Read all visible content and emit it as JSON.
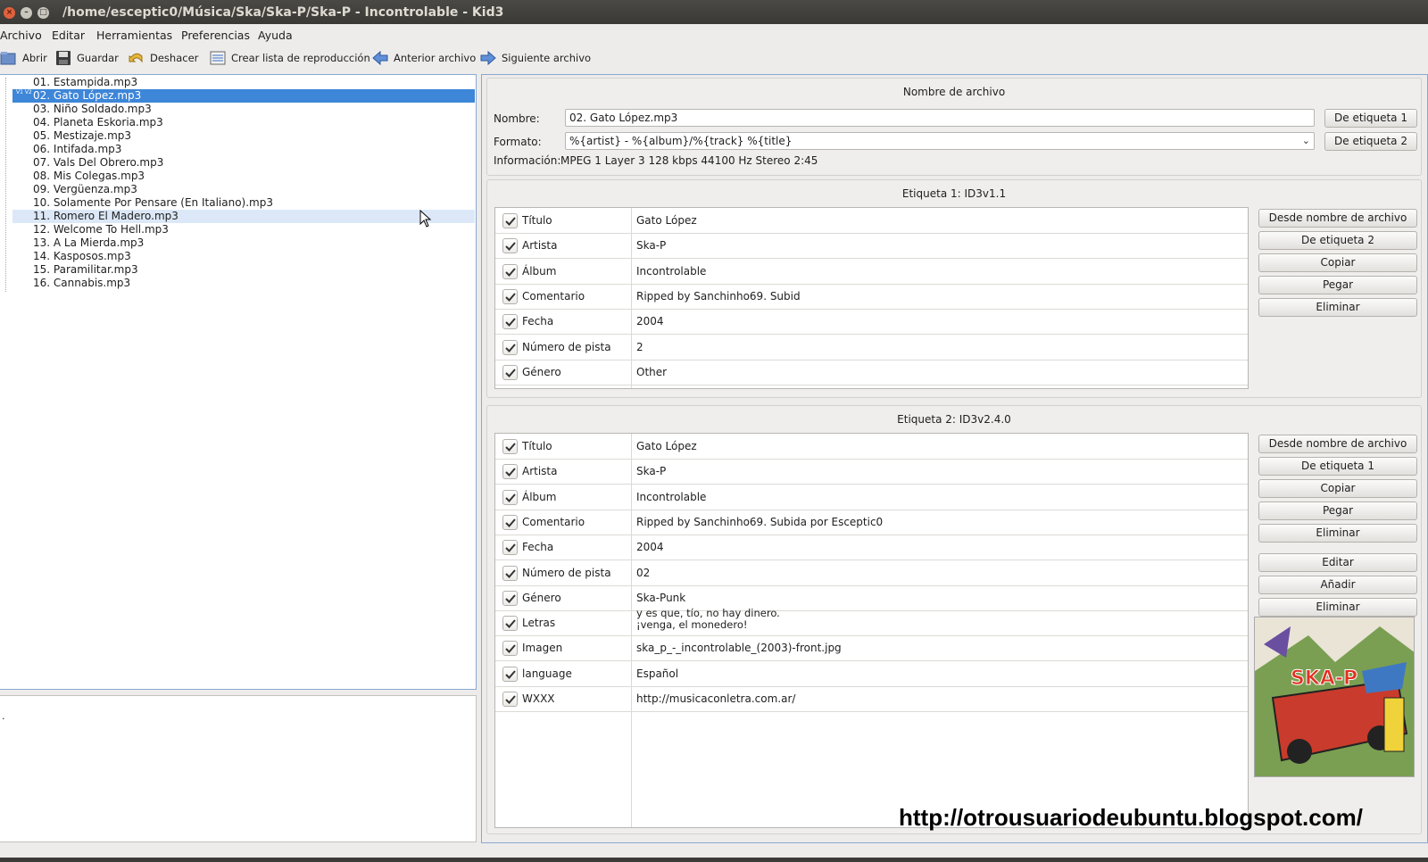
{
  "window": {
    "title": "/home/esceptic0/Música/Ska/Ska-P/Ska-P - Incontrolable - Kid3"
  },
  "menu": [
    "Archivo",
    "Editar",
    "Herramientas",
    "Preferencias",
    "Ayuda"
  ],
  "toolbar": {
    "open": "Abrir",
    "save": "Guardar",
    "undo": "Deshacer",
    "playlist": "Crear lista de reproducción",
    "prev": "Anterior archivo",
    "next": "Siguiente archivo"
  },
  "files": [
    "01. Estampida.mp3",
    "02. Gato López.mp3",
    "03. Niño Soldado.mp3",
    "04. Planeta Eskoria.mp3",
    "05. Mestizaje.mp3",
    "06. Intifada.mp3",
    "07. Vals Del Obrero.mp3",
    "08. Mis Colegas.mp3",
    "09. Vergüenza.mp3",
    "10. Solamente Por Pensare (En Italiano).mp3",
    "11. Romero El Madero.mp3",
    "12. Welcome To Hell.mp3",
    "13. A La Mierda.mp3",
    "14. Kasposos.mp3",
    "15. Paramilitar.mp3",
    "16. Cannabis.mp3"
  ],
  "file_badge": "V1\nV2",
  "info_panel_text": ".",
  "filename_section": {
    "title": "Nombre de archivo",
    "name_label": "Nombre:",
    "name_value": "02. Gato López.mp3",
    "format_label": "Formato:",
    "format_value": "%{artist} - %{album}/%{track} %{title}",
    "info_label": "Información:",
    "info_value": "MPEG 1 Layer 3 128 kbps 44100 Hz Stereo 2:45",
    "btn_from_tag1": "De etiqueta 1",
    "btn_from_tag2": "De etiqueta 2"
  },
  "tag1": {
    "title": "Etiqueta 1: ID3v1.1",
    "rows": [
      {
        "field": "Título",
        "value": "Gato López"
      },
      {
        "field": "Artista",
        "value": "Ska-P"
      },
      {
        "field": "Álbum",
        "value": "Incontrolable"
      },
      {
        "field": "Comentario",
        "value": "Ripped by Sanchinho69. Subid"
      },
      {
        "field": "Fecha",
        "value": "2004"
      },
      {
        "field": "Número de pista",
        "value": "2"
      },
      {
        "field": "Género",
        "value": "Other"
      }
    ],
    "buttons": {
      "from_filename": "Desde nombre de archivo",
      "from_tag": "De etiqueta 2",
      "copy": "Copiar",
      "paste": "Pegar",
      "delete": "Eliminar"
    }
  },
  "tag2": {
    "title": "Etiqueta 2: ID3v2.4.0",
    "rows": [
      {
        "field": "Título",
        "value": "Gato López"
      },
      {
        "field": "Artista",
        "value": "Ska-P"
      },
      {
        "field": "Álbum",
        "value": "Incontrolable"
      },
      {
        "field": "Comentario",
        "value": "Ripped by Sanchinho69. Subida por Esceptic0"
      },
      {
        "field": "Fecha",
        "value": "2004"
      },
      {
        "field": "Número de pista",
        "value": "02"
      },
      {
        "field": "Género",
        "value": "Ska-Punk"
      },
      {
        "field": "Letras",
        "value": "y es que, tío, no hay dinero.\n¡venga, el monedero!"
      },
      {
        "field": "Imagen",
        "value": "ska_p_-_incontrolable_(2003)-front.jpg"
      },
      {
        "field": "language",
        "value": "Español"
      },
      {
        "field": "WXXX",
        "value": "http://musicaconletra.com.ar/"
      }
    ],
    "buttons": {
      "from_filename": "Desde nombre de archivo",
      "from_tag": "De etiqueta 1",
      "copy": "Copiar",
      "paste": "Pegar",
      "delete": "Eliminar",
      "edit": "Editar",
      "add": "Añadir",
      "remove": "Eliminar"
    }
  },
  "cover_art_text": "SKA-P",
  "watermark": "http://otrousuariodeubuntu.blogspot.com/",
  "colors": {
    "selection": "#3d86d8",
    "accent_border": "#8aa8cf",
    "titlebar": "#3a3936"
  }
}
